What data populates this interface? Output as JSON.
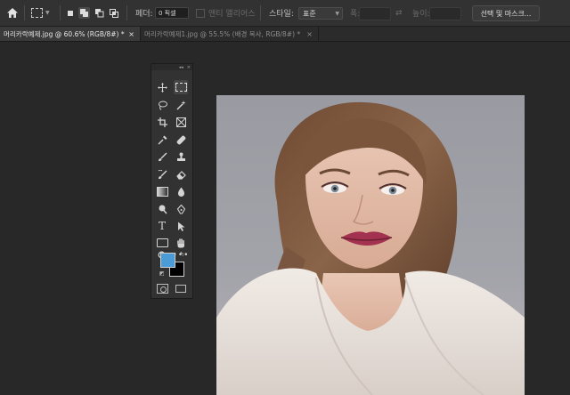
{
  "options_bar": {
    "feather_label": "페더:",
    "feather_value": "0 픽셀",
    "antialias_label": "앤티 앨리어스",
    "style_label": "스타일:",
    "style_value": "표준",
    "width_label": "폭:",
    "height_label": "높이:",
    "select_mask_label": "선택 및 마스크..."
  },
  "tabs": [
    {
      "label": "머리카락예제.jpg @ 60.6% (RGB/8#) *",
      "close": "×"
    },
    {
      "label": "머리카락예제1.jpg @ 55.5% (배경 복사, RGB/8#) *",
      "close": "×"
    }
  ],
  "toolbar": {
    "header_collapse": "◂◂",
    "header_close": "×"
  },
  "colors": {
    "foreground": "#4a9bd6",
    "background": "#000000",
    "canvas_bg": "#282828",
    "panel_bg": "#323232"
  },
  "icons": [
    "home-icon",
    "rectangular-marquee-icon",
    "move-icon",
    "marquee-icon",
    "lasso-icon",
    "magic-wand-icon",
    "crop-icon",
    "frame-icon",
    "eyedropper-icon",
    "spot-healing-icon",
    "brush-icon",
    "clone-stamp-icon",
    "history-brush-icon",
    "eraser-icon",
    "gradient-icon",
    "blur-icon",
    "dodge-icon",
    "pen-icon",
    "type-icon",
    "path-selection-icon",
    "rectangle-shape-icon",
    "hand-icon",
    "zoom-icon",
    "more-tools-icon"
  ]
}
